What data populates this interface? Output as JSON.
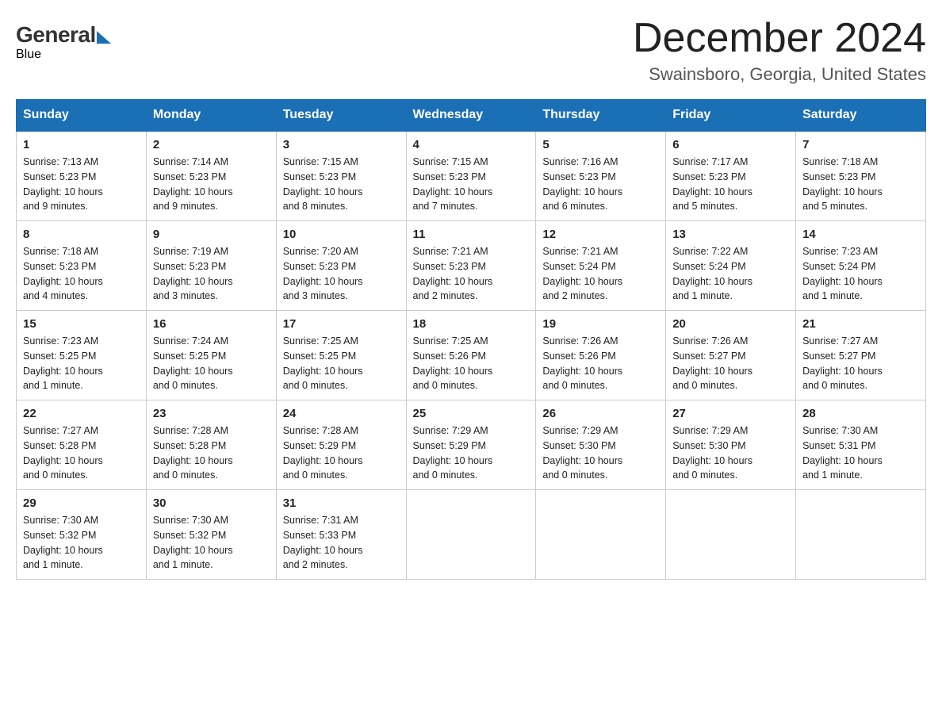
{
  "header": {
    "month_title": "December 2024",
    "subtitle": "Swainsboro, Georgia, United States",
    "logo_general": "General",
    "logo_blue": "Blue"
  },
  "days_of_week": [
    "Sunday",
    "Monday",
    "Tuesday",
    "Wednesday",
    "Thursday",
    "Friday",
    "Saturday"
  ],
  "weeks": [
    [
      {
        "day": "1",
        "sunrise": "7:13 AM",
        "sunset": "5:23 PM",
        "daylight": "10 hours and 9 minutes."
      },
      {
        "day": "2",
        "sunrise": "7:14 AM",
        "sunset": "5:23 PM",
        "daylight": "10 hours and 9 minutes."
      },
      {
        "day": "3",
        "sunrise": "7:15 AM",
        "sunset": "5:23 PM",
        "daylight": "10 hours and 8 minutes."
      },
      {
        "day": "4",
        "sunrise": "7:15 AM",
        "sunset": "5:23 PM",
        "daylight": "10 hours and 7 minutes."
      },
      {
        "day": "5",
        "sunrise": "7:16 AM",
        "sunset": "5:23 PM",
        "daylight": "10 hours and 6 minutes."
      },
      {
        "day": "6",
        "sunrise": "7:17 AM",
        "sunset": "5:23 PM",
        "daylight": "10 hours and 5 minutes."
      },
      {
        "day": "7",
        "sunrise": "7:18 AM",
        "sunset": "5:23 PM",
        "daylight": "10 hours and 5 minutes."
      }
    ],
    [
      {
        "day": "8",
        "sunrise": "7:18 AM",
        "sunset": "5:23 PM",
        "daylight": "10 hours and 4 minutes."
      },
      {
        "day": "9",
        "sunrise": "7:19 AM",
        "sunset": "5:23 PM",
        "daylight": "10 hours and 3 minutes."
      },
      {
        "day": "10",
        "sunrise": "7:20 AM",
        "sunset": "5:23 PM",
        "daylight": "10 hours and 3 minutes."
      },
      {
        "day": "11",
        "sunrise": "7:21 AM",
        "sunset": "5:23 PM",
        "daylight": "10 hours and 2 minutes."
      },
      {
        "day": "12",
        "sunrise": "7:21 AM",
        "sunset": "5:24 PM",
        "daylight": "10 hours and 2 minutes."
      },
      {
        "day": "13",
        "sunrise": "7:22 AM",
        "sunset": "5:24 PM",
        "daylight": "10 hours and 1 minute."
      },
      {
        "day": "14",
        "sunrise": "7:23 AM",
        "sunset": "5:24 PM",
        "daylight": "10 hours and 1 minute."
      }
    ],
    [
      {
        "day": "15",
        "sunrise": "7:23 AM",
        "sunset": "5:25 PM",
        "daylight": "10 hours and 1 minute."
      },
      {
        "day": "16",
        "sunrise": "7:24 AM",
        "sunset": "5:25 PM",
        "daylight": "10 hours and 0 minutes."
      },
      {
        "day": "17",
        "sunrise": "7:25 AM",
        "sunset": "5:25 PM",
        "daylight": "10 hours and 0 minutes."
      },
      {
        "day": "18",
        "sunrise": "7:25 AM",
        "sunset": "5:26 PM",
        "daylight": "10 hours and 0 minutes."
      },
      {
        "day": "19",
        "sunrise": "7:26 AM",
        "sunset": "5:26 PM",
        "daylight": "10 hours and 0 minutes."
      },
      {
        "day": "20",
        "sunrise": "7:26 AM",
        "sunset": "5:27 PM",
        "daylight": "10 hours and 0 minutes."
      },
      {
        "day": "21",
        "sunrise": "7:27 AM",
        "sunset": "5:27 PM",
        "daylight": "10 hours and 0 minutes."
      }
    ],
    [
      {
        "day": "22",
        "sunrise": "7:27 AM",
        "sunset": "5:28 PM",
        "daylight": "10 hours and 0 minutes."
      },
      {
        "day": "23",
        "sunrise": "7:28 AM",
        "sunset": "5:28 PM",
        "daylight": "10 hours and 0 minutes."
      },
      {
        "day": "24",
        "sunrise": "7:28 AM",
        "sunset": "5:29 PM",
        "daylight": "10 hours and 0 minutes."
      },
      {
        "day": "25",
        "sunrise": "7:29 AM",
        "sunset": "5:29 PM",
        "daylight": "10 hours and 0 minutes."
      },
      {
        "day": "26",
        "sunrise": "7:29 AM",
        "sunset": "5:30 PM",
        "daylight": "10 hours and 0 minutes."
      },
      {
        "day": "27",
        "sunrise": "7:29 AM",
        "sunset": "5:30 PM",
        "daylight": "10 hours and 0 minutes."
      },
      {
        "day": "28",
        "sunrise": "7:30 AM",
        "sunset": "5:31 PM",
        "daylight": "10 hours and 1 minute."
      }
    ],
    [
      {
        "day": "29",
        "sunrise": "7:30 AM",
        "sunset": "5:32 PM",
        "daylight": "10 hours and 1 minute."
      },
      {
        "day": "30",
        "sunrise": "7:30 AM",
        "sunset": "5:32 PM",
        "daylight": "10 hours and 1 minute."
      },
      {
        "day": "31",
        "sunrise": "7:31 AM",
        "sunset": "5:33 PM",
        "daylight": "10 hours and 2 minutes."
      },
      null,
      null,
      null,
      null
    ]
  ],
  "labels": {
    "sunrise_label": "Sunrise:",
    "sunset_label": "Sunset:",
    "daylight_label": "Daylight:"
  }
}
